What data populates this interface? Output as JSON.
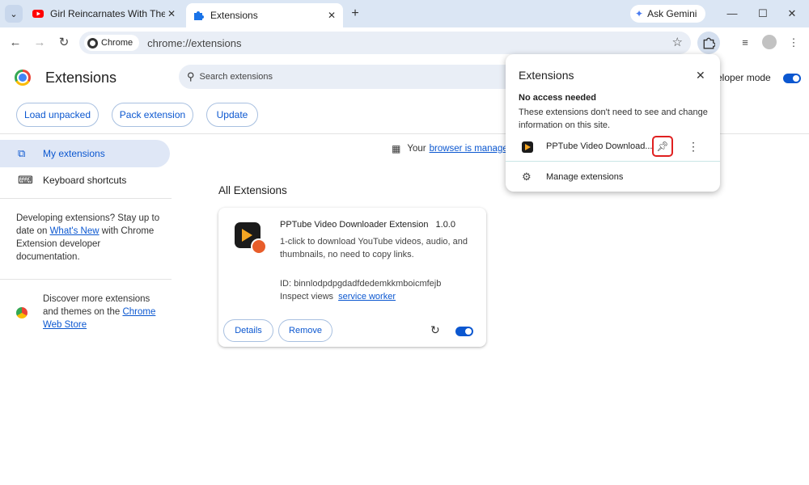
{
  "browser": {
    "tabs": [
      {
        "title": "Girl Reincarnates With The AI"
      },
      {
        "title": "Extensions"
      }
    ],
    "gemini_label": "Ask Gemini",
    "omnibox": {
      "chip": "Chrome",
      "url": "chrome://extensions"
    }
  },
  "page": {
    "title": "Extensions",
    "search_placeholder": "Search extensions",
    "dev_mode_label": "eloper mode",
    "buttons": {
      "load_unpacked": "Load unpacked",
      "pack": "Pack extension",
      "update": "Update"
    }
  },
  "sidebar": {
    "my_extensions": "My extensions",
    "keyboard_shortcuts": "Keyboard shortcuts",
    "dev_text_pre": "Developing extensions? Stay up to date on",
    "dev_link": "What's New",
    "dev_text_post": "with Chrome Extension developer documentation.",
    "discover_text": "Discover more extensions and themes on the",
    "store_link": "Chrome Web Store"
  },
  "main": {
    "managed_text": "Your",
    "managed_link": "browser is managed",
    "section_title": "All Extensions",
    "card": {
      "name": "PPTube Video Downloader Extension",
      "version": "1.0.0",
      "description": "1-click to download YouTube videos, audio, and thumbnails, no need to copy links.",
      "id_text": "ID: binnlodpdpgdadfdedemkkmboicmfejb",
      "inspect_label": "Inspect views",
      "inspect_link": "service worker",
      "details": "Details",
      "remove": "Remove"
    }
  },
  "popup": {
    "title": "Extensions",
    "subheading": "No access needed",
    "description": "These extensions don't need to see and change information on this site.",
    "ext_name": "PPTube Video Download...",
    "manage": "Manage extensions"
  },
  "colors": {
    "accent": "#0b57d0",
    "tabstrip": "#dbe6f4",
    "highlight": "#e02020"
  }
}
